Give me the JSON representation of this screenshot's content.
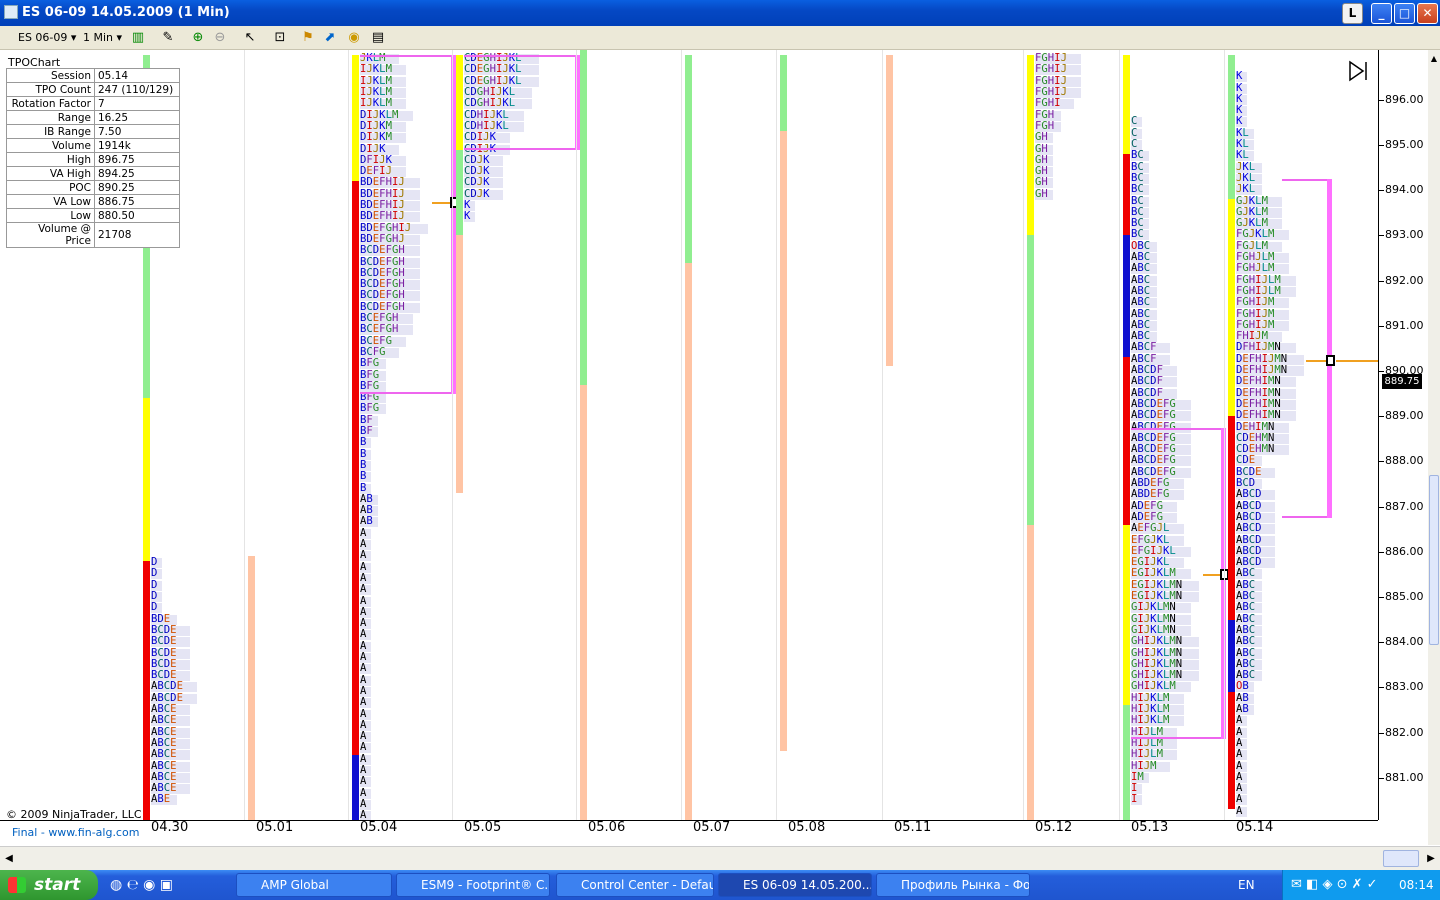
{
  "window": {
    "title": "ES 06-09  14.05.2009 (1 Min)",
    "btn_l": "L",
    "btn_min": "_",
    "btn_max": "□",
    "btn_close": "✕"
  },
  "toolbar": {
    "instrument": "ES 06-09",
    "interval": "1 Min"
  },
  "chart": {
    "name": "TPOChart",
    "copyright": "© 2009 NinjaTrader, LLC",
    "footer": "Final - www.fin-alg.com",
    "last_price": "889.75",
    "info": [
      {
        "k": "Session",
        "v": "05.14"
      },
      {
        "k": "TPO Count",
        "v": "247 (110/129)"
      },
      {
        "k": "Rotation Factor",
        "v": "7"
      },
      {
        "k": "Range",
        "v": "16.25"
      },
      {
        "k": "IB Range",
        "v": "7.50"
      },
      {
        "k": "Volume",
        "v": "1914k"
      },
      {
        "k": "High",
        "v": "896.75"
      },
      {
        "k": "VA High",
        "v": "894.25"
      },
      {
        "k": "POC",
        "v": "890.25"
      },
      {
        "k": "VA Low",
        "v": "886.75"
      },
      {
        "k": "Low",
        "v": "880.50"
      },
      {
        "k": "Volume @ Price",
        "v": "21708"
      }
    ]
  },
  "chart_data": {
    "type": "table",
    "title": "",
    "y_ticks": [
      "896.00",
      "895.00",
      "894.00",
      "893.00",
      "892.00",
      "891.00",
      "890.00",
      "889.00",
      "888.00",
      "887.00",
      "886.00",
      "885.00",
      "884.00",
      "883.00",
      "882.00",
      "881.00"
    ],
    "x_labels": [
      "04.30",
      "05.01",
      "05.04",
      "05.05",
      "05.06",
      "05.07",
      "05.08",
      "05.11",
      "05.12",
      "05.13",
      "05.14"
    ],
    "ylim": [
      880.0,
      897.0
    ],
    "sessions": [
      {
        "date": "04.30",
        "high": 897.0,
        "low": 880.0,
        "tpo_top": 885.75,
        "rows": [
          "D",
          "D",
          "D",
          "D",
          "D",
          "BDE",
          "BCDE",
          "BCDE",
          "BCDE",
          "BCDE",
          "BCDE",
          "ABCDE",
          "ABCDE",
          "ABCE",
          "ABCE",
          "ABCE",
          "ABCE",
          "ABCE",
          "ABCE",
          "ABCE",
          "ABCE",
          "ABE"
        ]
      },
      {
        "date": "05.01",
        "high": 885.9,
        "low": 880.0
      },
      {
        "date": "05.04",
        "high": 897.0,
        "low": 880.0,
        "tpo_top": 896.9,
        "rows": [
          "JKLM",
          "IJKLM",
          "IJKLM",
          "IJKLM",
          "IJKLM",
          "DIJKLM",
          "DIJKM",
          "DIJKM",
          "DIJK",
          "DFIJK",
          "DEFIJ",
          "BDEFHIJ",
          "BDEFHIJ",
          "BDEFHIJ",
          "BDEFHIJ",
          "BDEFGHIJ",
          "BDEFGHJ",
          "BCDEFGH",
          "BCDEFGH",
          "BCDEFGH",
          "BCDEFGH",
          "BCDEFGH",
          "BCDEFGH",
          "BCEFGH",
          "BCEFGH",
          "BCEFG",
          "BCFG",
          "BFG",
          "BFG",
          "BFG",
          "BFG",
          "BFG",
          "BF",
          "BF",
          "B",
          "B",
          "B",
          "B",
          "B",
          "AB",
          "AB",
          "AB",
          "A",
          "A",
          "A",
          "A",
          "A",
          "A",
          "A",
          "A",
          "A",
          "A",
          "A",
          "A",
          "A",
          "A",
          "A",
          "A",
          "A",
          "A",
          "A",
          "A",
          "A",
          "A",
          "A",
          "A",
          "A",
          "A"
        ],
        "poc": 893.75,
        "va_high": 897.0,
        "va_low": 889.5
      },
      {
        "date": "05.05",
        "high": 897.0,
        "low": 887.3,
        "tpo_top": 896.9,
        "rows": [
          "CDEGHIJKL",
          "CDEGHIJKL",
          "CDEGHIJKL",
          "CDGHIJKL",
          "CDGHIJKL",
          "CDHIJKL",
          "CDHIJKL",
          "CDIJK",
          "CDIJK",
          "CDJK",
          "CDJK",
          "CDJK",
          "CDJK",
          "K",
          "K"
        ],
        "va_high": 897.0,
        "va_low": 894.9
      },
      {
        "date": "05.06",
        "high": 897.0,
        "low": 880.0
      },
      {
        "date": "05.07",
        "high": 897.0,
        "low": 880.0
      },
      {
        "date": "05.08",
        "high": 897.0,
        "low": 881.6
      },
      {
        "date": "05.11",
        "high": 897.0,
        "low": 890.1
      },
      {
        "date": "05.12",
        "high": 897.0,
        "low": 880.0,
        "tpo_top": 896.9,
        "rows": [
          "FGHIJ",
          "FGHIJ",
          "FGHIJ",
          "FGHIJ",
          "FGHI",
          "FGH",
          "FGH",
          "GH",
          "GH",
          "GH",
          "GH",
          "GH",
          "GH"
        ]
      },
      {
        "date": "05.13",
        "high": 897.0,
        "low": 880.0,
        "tpo_top": 895.5,
        "rows": [
          "C",
          "C",
          "C",
          "BC",
          "BC",
          "BC",
          "BC",
          "BC",
          "BC",
          "BC",
          "BC",
          "OBC",
          "ABC",
          "ABC",
          "ABC",
          "ABC",
          "ABC",
          "ABC",
          "ABC",
          "ABC",
          "ABCF",
          "ABCF",
          "ABCDF",
          "ABCDF",
          "ABCDF",
          "ABCDEFG",
          "ABCDEFG",
          "ABCDEFG",
          "ABCDEFG",
          "ABCDEFG",
          "ABCDEFG",
          "ABCDEFG",
          "ABDEFG",
          "ABDEFG",
          "ADEFG",
          "ADEFG",
          "AEFGJL",
          "EFGJKL",
          "EFGIJKL",
          "EGIJKL",
          "EGIJKLM",
          "EGIJKLMN",
          "EGIJKLMN",
          "GIJKLMN",
          "GIJKLMN",
          "GIJKLMN",
          "GHIJKLMN",
          "GHIJKLMN",
          "GHIJKLMN",
          "GHIJKLMN",
          "GHIJKLM",
          "HIJKLM",
          "HIJKLM",
          "HIJKLM",
          "HIJLM",
          "HIJLM",
          "HIJLM",
          "HIJM",
          "IM",
          "I",
          "I"
        ],
        "poc": 885.5,
        "va_high": 888.75,
        "va_low": 881.85
      },
      {
        "date": "05.14",
        "high": 896.75,
        "low": 880.5,
        "tpo_top": 896.5,
        "rows": [
          "K",
          "K",
          "K",
          "K",
          "K",
          "KL",
          "KL",
          "KL",
          "JKL",
          "JKL",
          "JKL",
          "GJKLM",
          "GJKLM",
          "GJKLM",
          "FGJKLM",
          "FGJLM",
          "FGHJLM",
          "FGHJLM",
          "FGHIJLM",
          "FGHIJLM",
          "FGHIJM",
          "FGHIJM",
          "FGHIJM",
          "FHIJM",
          "DFHIJMN",
          "DEFHIJMN",
          "DEFHIJMN",
          "DEFHIMN",
          "DEFHIMN",
          "DEFHIMN",
          "DEFHIMN",
          "DEHIMN",
          "CDEHMN",
          "CDEHMN",
          "CDE",
          "BCDE",
          "BCD",
          "ABCD",
          "ABCD",
          "ABCD",
          "ABCD",
          "ABCD",
          "ABCD",
          "ABCD",
          "ABC",
          "ABC",
          "ABC",
          "ABC",
          "ABC",
          "ABC",
          "ABC",
          "ABC",
          "ABC",
          "ABC",
          "OB",
          "AB",
          "AB",
          "A",
          "A",
          "A",
          "A",
          "A",
          "A",
          "A",
          "A",
          "A",
          "A"
        ],
        "poc": 890.25,
        "va_high": 894.25,
        "va_low": 886.75
      }
    ]
  },
  "taskbar": {
    "start": "start",
    "items": [
      "AMP Global",
      "ESM9 - Footprint® C...",
      "Control Center - Default",
      "ES 06-09  14.05.200...",
      "Профиль Рынка - Фо..."
    ],
    "lang": "EN",
    "clock": "08:14"
  }
}
